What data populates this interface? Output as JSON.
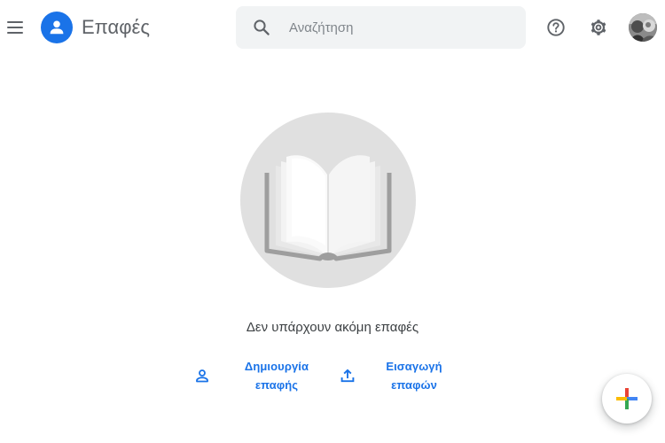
{
  "header": {
    "menu_icon": "hamburger-menu-icon",
    "app_icon": "person-icon",
    "title": "Επαφές",
    "search": {
      "placeholder": "Αναζήτηση",
      "value": ""
    },
    "help_icon": "help-circle-icon",
    "settings_icon": "gear-icon",
    "avatar_icon": "user-avatar"
  },
  "empty_state": {
    "illustration": "open-book-icon",
    "message": "Δεν υπάρχουν ακόμη επαφές",
    "actions": {
      "create": {
        "line1": "Δημιουργία",
        "line2": "επαφής",
        "icon": "person-outline-icon"
      },
      "import": {
        "line1": "Εισαγωγή",
        "line2": "επαφών",
        "icon": "upload-icon"
      }
    }
  },
  "fab": {
    "icon": "multicolor-plus-icon"
  },
  "colors": {
    "accent": "#1a73e8",
    "icon_gray": "#5f6368",
    "search_bg": "#f1f3f4",
    "illustration_bg": "#e0e0e0",
    "google_red": "#ea4335",
    "google_blue": "#4285f4",
    "google_yellow": "#fbbc04",
    "google_green": "#34a853"
  }
}
